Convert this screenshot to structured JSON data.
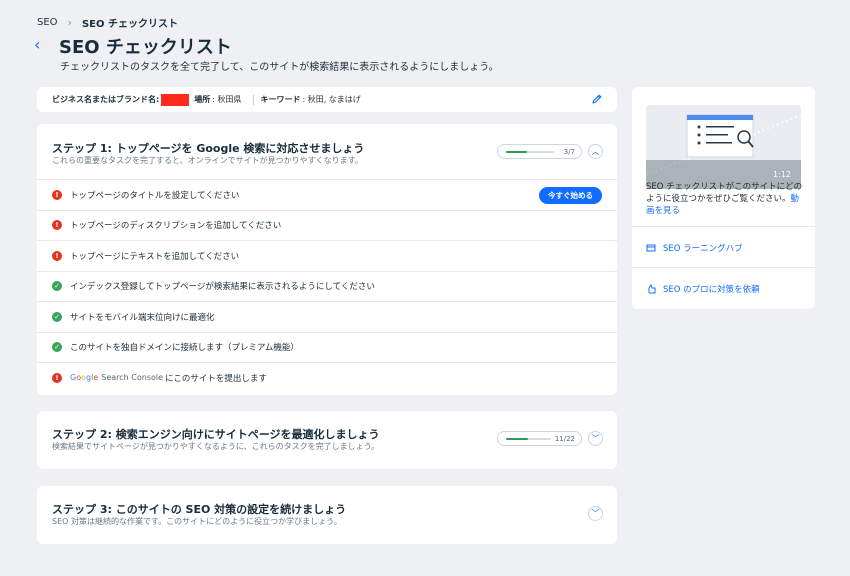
{
  "breadcrumb": {
    "root": "SEO",
    "current": "SEO チェックリスト"
  },
  "page": {
    "title": "SEO チェックリスト",
    "subtitle": "チェックリストのタスクを全て完了して、このサイトが検索結果に表示されるようにしましょう。"
  },
  "info_bar": {
    "business_label": "ビジネス名またはブランド名:",
    "location_label": "場所",
    "location_value": ": 秋田県",
    "keyword_label": "キーワード",
    "keyword_value": ": 秋田, なまはげ"
  },
  "step1": {
    "title": "ステップ 1: トップページを Google 検索に対応させましょう",
    "subtitle": "これらの重要なタスクを完了すると、オンラインでサイトが見つかりやすくなります。",
    "progress_text": "3/7",
    "progress": 0.43,
    "tasks": [
      {
        "label": "トップページのタイトルを設定してください",
        "status": "incomplete",
        "action": "今すぐ始める"
      },
      {
        "label": "トップページのディスクリプションを追加してください",
        "status": "incomplete"
      },
      {
        "label": "トップページにテキストを追加してください",
        "status": "incomplete"
      },
      {
        "label": "インデックス登録してトップページが検索結果に表示されるようにしてください",
        "status": "complete"
      },
      {
        "label": "サイトをモバイル端末位向けに最適化",
        "status": "complete"
      },
      {
        "label": "このサイトを独自ドメインに接続します（プレミアム機能）",
        "status": "complete"
      },
      {
        "label": "にこのサイトを提出します",
        "status": "incomplete",
        "logo_text": [
          "G",
          "o",
          "o",
          "g",
          "l",
          "e"
        ],
        "logo_suffix": "Search Console"
      }
    ]
  },
  "step2": {
    "title": "ステップ 2: 検索エンジン向けにサイトページを最適化しましょう",
    "subtitle": "検索結果でサイトページが見つかりやすくなるように、これらのタスクを完了しましょう。",
    "progress_text": "11/22",
    "progress": 0.5
  },
  "step3": {
    "title": "ステップ 3: このサイトの SEO 対策の設定を続けましょう",
    "subtitle": "SEO 対策は継続的な作業です。このサイトにどのように役立つか学びましょう。"
  },
  "sidebar": {
    "video_duration": "1:12",
    "description": "SEO チェックリストがこのサイトにどのように役立つかをぜひご覧ください。",
    "video_link": "動画を見る",
    "learning_hub": "SEO ラーニングハブ",
    "hire_expert": "SEO のプロに対策を依頼"
  },
  "colors": {
    "accent": "#116dff",
    "error": "#e6331f",
    "success": "#37a35c",
    "progress": "#2f9b4e"
  }
}
